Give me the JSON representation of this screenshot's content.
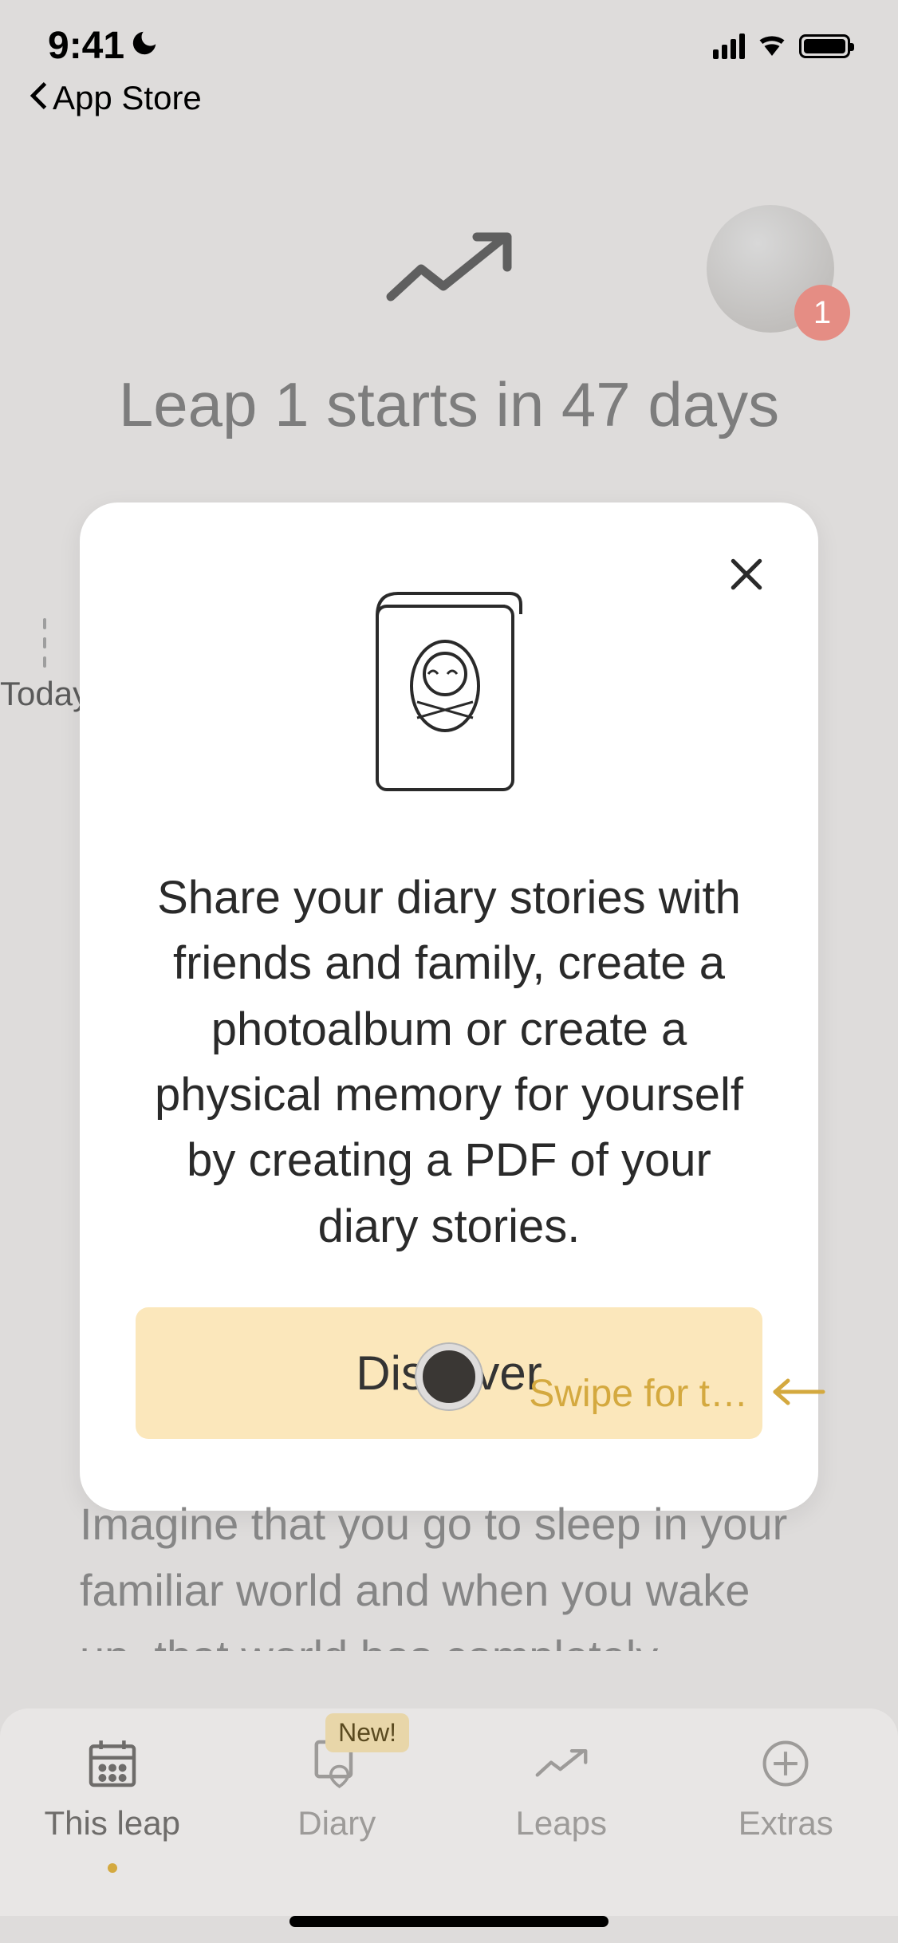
{
  "status": {
    "time": "9:41",
    "back_label": "App Store"
  },
  "header": {
    "title": "Leap 1 starts in 47 days",
    "badge_count": "1"
  },
  "timeline": {
    "today_label": "Today"
  },
  "modal": {
    "text": "Share your diary stories with friends and family, create a photoalbum or create a physical memory for yourself by creating a PDF of your diary stories.",
    "cta_label": "Discover"
  },
  "swipe_hint": "Swipe for t…",
  "body_text": "Imagine that you go to sleep in your familiar world and when you wake up, that world has completely changed.    Wouldn't it upset you?",
  "tabs": {
    "this_leap": "This leap",
    "diary": "Diary",
    "diary_badge": "New!",
    "leaps": "Leaps",
    "extras": "Extras"
  }
}
